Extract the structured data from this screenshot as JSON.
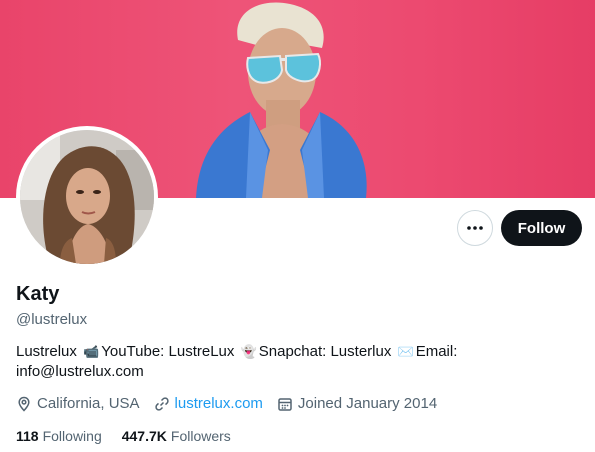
{
  "profile": {
    "name": "Katy",
    "handle": "@lustrelux",
    "bio": {
      "part1": "Lustrelux",
      "part2": "YouTube: LustreLux",
      "part3": "Snapchat: Lusterlux",
      "part4": "Email:",
      "part5": "info@lustrelux.com"
    },
    "location": "California, USA",
    "website": "lustrelux.com",
    "joined": "Joined January 2014"
  },
  "stats": {
    "following_count": "118",
    "following_label": "Following",
    "followers_count": "447.7K",
    "followers_label": "Followers"
  },
  "actions": {
    "follow_label": "Follow",
    "more_icon": "more-horizontal-icon"
  },
  "icons": {
    "bio_emoji_1": "movie-camera-icon",
    "bio_emoji_2": "ghost-icon",
    "bio_emoji_3": "envelope-icon",
    "location": "location-pin-icon",
    "link": "link-icon",
    "calendar": "calendar-icon"
  },
  "colors": {
    "banner": "#ec4a70",
    "follow_button": "#0f1419",
    "link": "#1d9bf0",
    "secondary_text": "#536471"
  }
}
